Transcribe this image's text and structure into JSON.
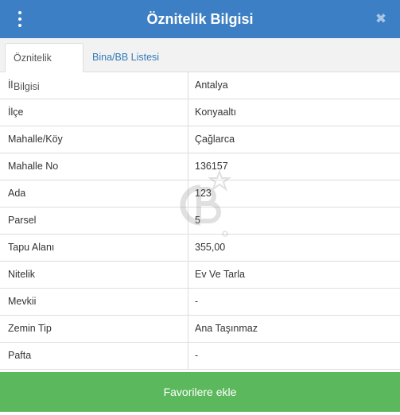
{
  "header": {
    "title": "Öznitelik Bilgisi",
    "menu_icon": "kebab-menu-icon",
    "close_icon": "close-icon",
    "background_color": "#3d7fc4"
  },
  "tabs": [
    {
      "label": "Öznitelik Bilgisi",
      "active": true
    },
    {
      "label": "Bina/BB Listesi",
      "active": false
    }
  ],
  "rows": [
    {
      "label": "İl",
      "value": "Antalya"
    },
    {
      "label": "İlçe",
      "value": "Konyaaltı"
    },
    {
      "label": "Mahalle/Köy",
      "value": "Çağlarca"
    },
    {
      "label": "Mahalle No",
      "value": "136157"
    },
    {
      "label": "Ada",
      "value": "123"
    },
    {
      "label": "Parsel",
      "value": "5"
    },
    {
      "label": "Tapu Alanı",
      "value": "355,00"
    },
    {
      "label": "Nitelik",
      "value": "Ev Ve Tarla"
    },
    {
      "label": "Mevkii",
      "value": "-"
    },
    {
      "label": "Zemin Tip",
      "value": "Ana Taşınmaz"
    },
    {
      "label": "Pafta",
      "value": "-"
    }
  ],
  "watermark_icon": "cb-logo-watermark",
  "footer": {
    "button_label": "Favorilere ekle",
    "button_color": "#5cb85c"
  }
}
